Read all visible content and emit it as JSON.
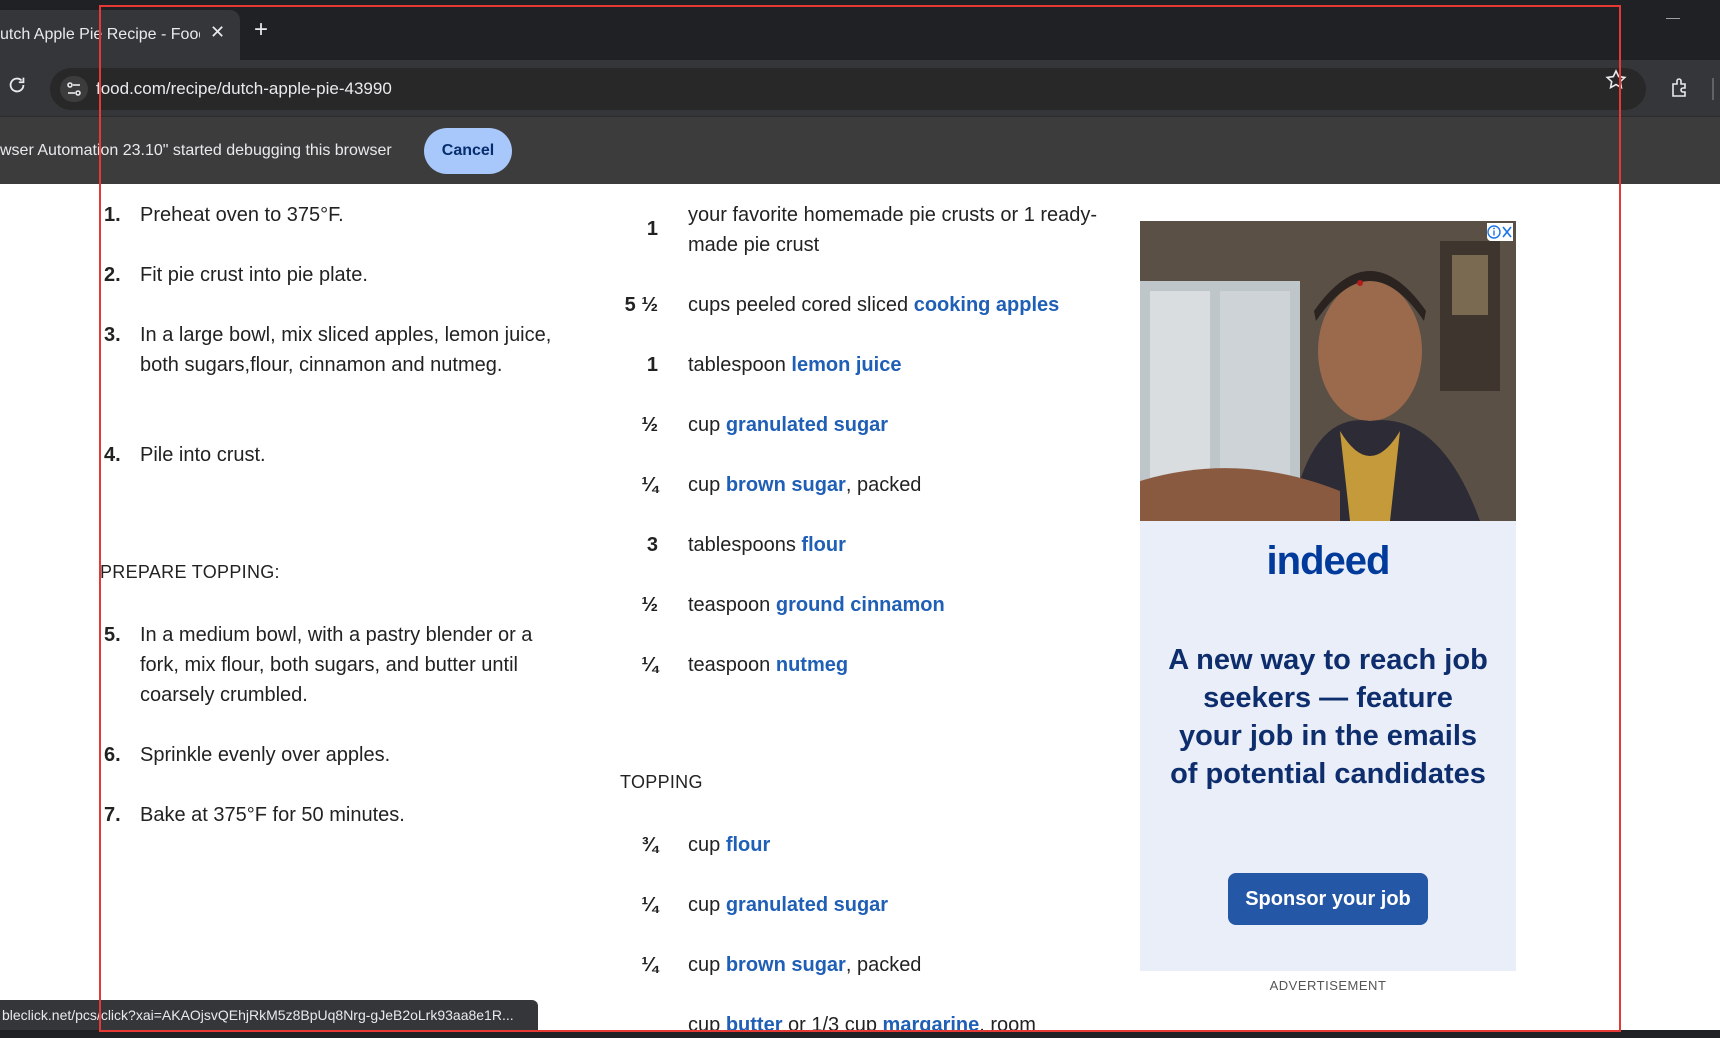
{
  "browser": {
    "tab_title": "utch Apple Pie Recipe - Food.",
    "url": "food.com/recipe/dutch-apple-pie-43990",
    "infobar_text": "wser Automation 23.10\" started debugging this browser",
    "cancel_label": "Cancel",
    "status_url": "bleclick.net/pcs/click?xai=AKAOjsvQEhjRkM5z8BpUq8Nrg-gJeB2oLrk93aa8e1R..."
  },
  "directions": {
    "steps": [
      {
        "num": "1.",
        "text": "Preheat oven to 375°F."
      },
      {
        "num": "2.",
        "text": "Fit pie crust into pie plate."
      },
      {
        "num": "3.",
        "text": "In a large bowl, mix sliced apples, lemon juice, both sugars,flour, cinnamon and nutmeg."
      },
      {
        "num": "4.",
        "text": "Pile into crust."
      },
      {
        "num": "5.",
        "text": "In a medium bowl, with a pastry blender or a fork, mix flour, both sugars, and butter until coarsely crumbled."
      },
      {
        "num": "6.",
        "text": "Sprinkle evenly over apples."
      },
      {
        "num": "7.",
        "text": "Bake at 375°F for 50 minutes."
      }
    ],
    "prepare_topping_heading": "PREPARE TOPPING:"
  },
  "ingredients": {
    "main": [
      {
        "qty": "1",
        "pre": "your favorite homemade pie crusts or 1 ready-made pie crust",
        "link": "",
        "post": ""
      },
      {
        "qty": "5 ½",
        "pre": "cups peeled cored sliced ",
        "link": "cooking apples",
        "post": ""
      },
      {
        "qty": "1",
        "pre": "tablespoon ",
        "link": "lemon juice",
        "post": ""
      },
      {
        "qty": "½",
        "pre": "cup ",
        "link": "granulated sugar",
        "post": ""
      },
      {
        "qty": "¼",
        "pre": "cup ",
        "link": "brown sugar",
        "post": ", packed"
      },
      {
        "qty": "3",
        "pre": "tablespoons ",
        "link": "flour",
        "post": ""
      },
      {
        "qty": "½",
        "pre": "teaspoon ",
        "link": "ground cinnamon",
        "post": ""
      },
      {
        "qty": "¼",
        "pre": "teaspoon ",
        "link": "nutmeg",
        "post": ""
      }
    ],
    "topping_heading": "TOPPING",
    "topping": [
      {
        "qty": "¾",
        "pre": "cup ",
        "link": "flour",
        "post": ""
      },
      {
        "qty": "¼",
        "pre": "cup ",
        "link": "granulated sugar",
        "post": ""
      },
      {
        "qty": "¼",
        "pre": "cup ",
        "link": "brown sugar",
        "post": ", packed"
      },
      {
        "qty": "",
        "pre": "cup ",
        "link": "butter",
        "post": " or 1/3 cup ",
        "link2": "margarine",
        "post2": ", room"
      }
    ]
  },
  "ad": {
    "brand": "indeed",
    "headline": "A new way to reach job seekers — feature your job in the emails of potential candidates",
    "button": "Sponsor your job",
    "label": "ADVERTISEMENT"
  }
}
